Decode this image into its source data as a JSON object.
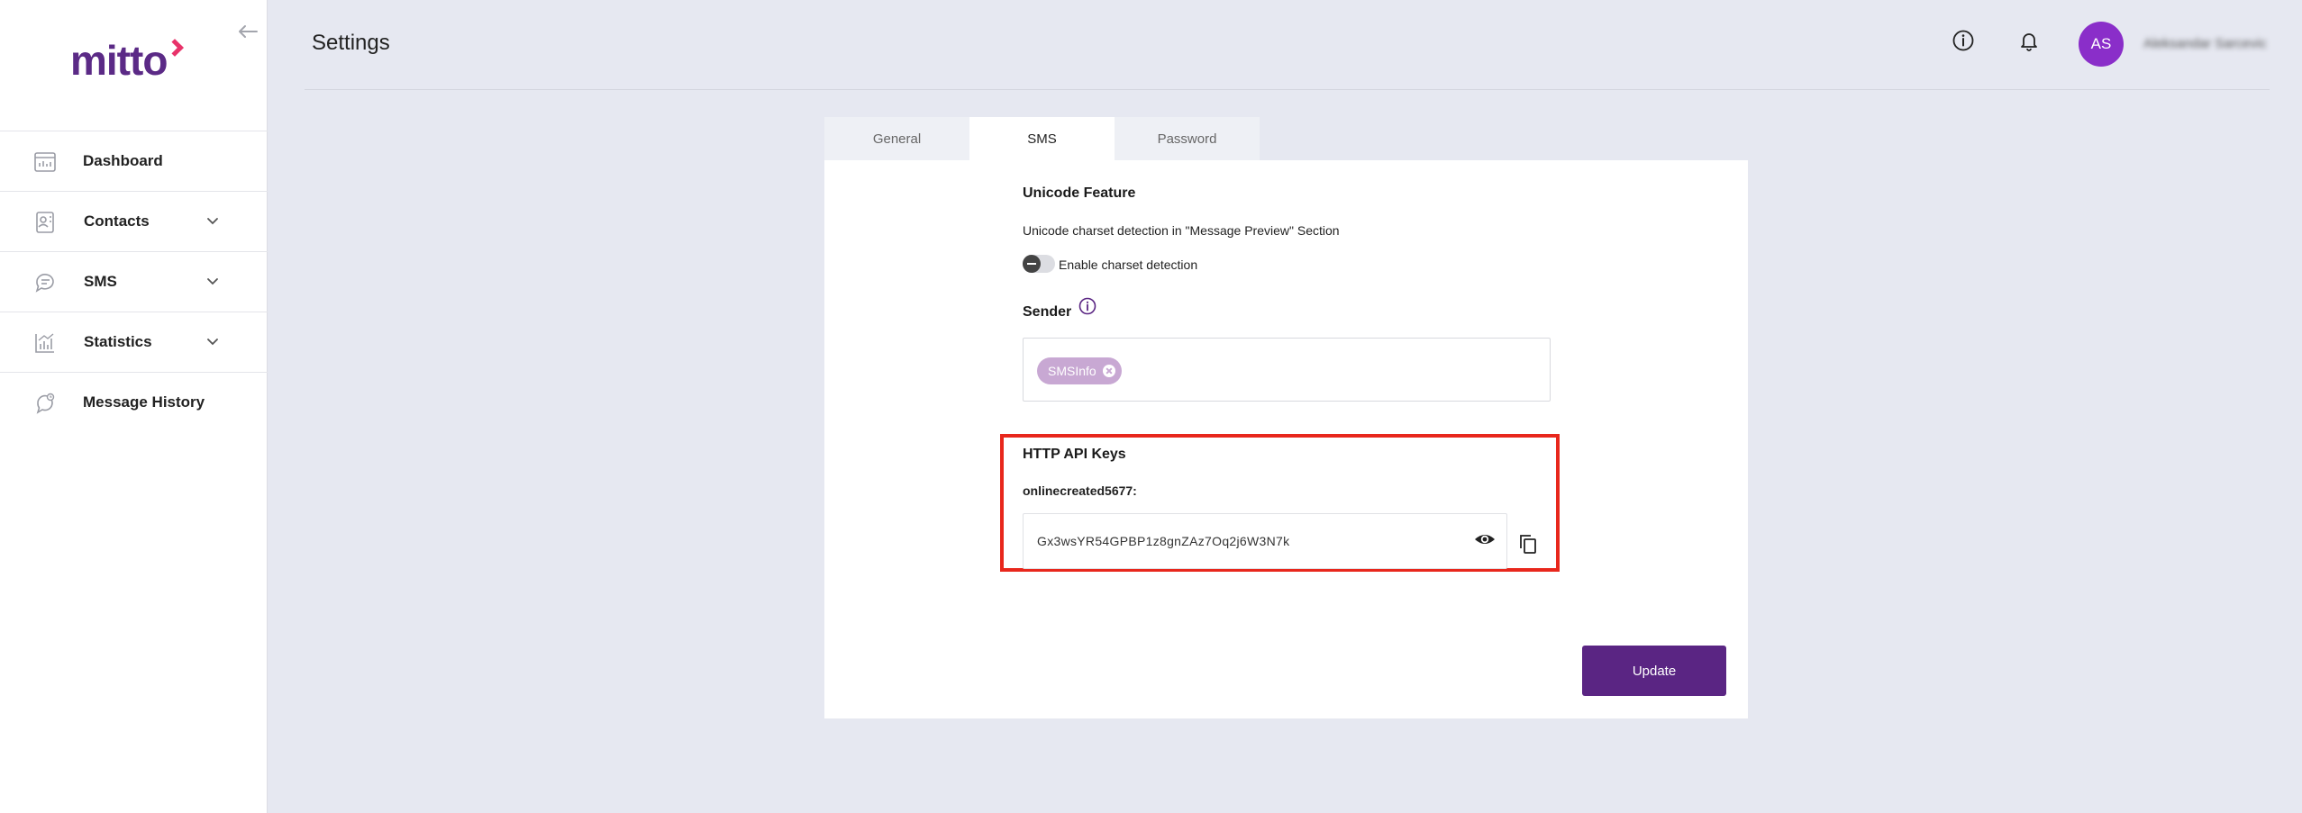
{
  "brand": {
    "logo_text": "mitto",
    "accent": "#5b2a86",
    "accent2": "#e8336a"
  },
  "sidebar": {
    "items": [
      {
        "label": "Dashboard",
        "icon": "dashboard-icon",
        "expandable": false
      },
      {
        "label": "Contacts",
        "icon": "contacts-icon",
        "expandable": true
      },
      {
        "label": "SMS",
        "icon": "sms-icon",
        "expandable": true
      },
      {
        "label": "Statistics",
        "icon": "statistics-icon",
        "expandable": true
      },
      {
        "label": "Message History",
        "icon": "message-history-icon",
        "expandable": false
      }
    ]
  },
  "header": {
    "title": "Settings",
    "avatar_initials": "AS",
    "username": "Aleksandar Sarcevic"
  },
  "tabs": [
    {
      "label": "General",
      "active": false
    },
    {
      "label": "SMS",
      "active": true
    },
    {
      "label": "Password",
      "active": false
    }
  ],
  "unicode": {
    "title": "Unicode Feature",
    "description": "Unicode charset detection in \"Message Preview\" Section",
    "toggle_label": "Enable charset detection",
    "enabled": false
  },
  "sender": {
    "title": "Sender",
    "chips": [
      "SMSInfo"
    ]
  },
  "api_keys": {
    "title": "HTTP API Keys",
    "account_label": "onlinecreated5677:",
    "key_value": "Gx3wsYR54GPBP1z8gnZAz7Oq2j6W3N7k"
  },
  "actions": {
    "update_label": "Update"
  }
}
